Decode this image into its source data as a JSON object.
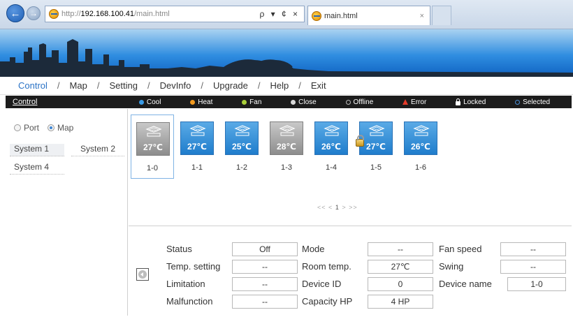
{
  "browser": {
    "url_proto": "http://",
    "url_host": "192.168.100.41",
    "url_path": "/main.html",
    "tools": "ρ ▾ ¢ ×",
    "tab_title": "main.html",
    "tab_close": "×"
  },
  "menu": {
    "items": [
      "Control",
      "Map",
      "Setting",
      "DevInfo",
      "Upgrade",
      "Help",
      "Exit"
    ],
    "active": "Control",
    "separator": "/"
  },
  "legend": {
    "title": "Control",
    "items": [
      {
        "label": "Cool",
        "color": "#3a9be6"
      },
      {
        "label": "Heat",
        "color": "#f29a1f"
      },
      {
        "label": "Fan",
        "color": "#a9cf3a"
      },
      {
        "label": "Close",
        "color": "#d9d9d9"
      },
      {
        "label": "Offline",
        "color": "#bbbbbb"
      },
      {
        "label": "Error",
        "color": "#e53b2a"
      },
      {
        "label": "Locked",
        "color": "#ffffff"
      },
      {
        "label": "Selected",
        "color": "#4a90d9"
      }
    ]
  },
  "left": {
    "modes": [
      "Port",
      "Map"
    ],
    "mode_selected": "Map",
    "systems": [
      "System 1",
      "System 2",
      "System 4"
    ],
    "system_selected": "System 1"
  },
  "devices": [
    {
      "name": "1-0",
      "temp": "27℃",
      "state": "offline",
      "selected": true,
      "locked": false
    },
    {
      "name": "1-1",
      "temp": "27℃",
      "state": "cool",
      "selected": false,
      "locked": false
    },
    {
      "name": "1-2",
      "temp": "25℃",
      "state": "cool",
      "selected": false,
      "locked": false
    },
    {
      "name": "1-3",
      "temp": "28℃",
      "state": "offline",
      "selected": false,
      "locked": false
    },
    {
      "name": "1-4",
      "temp": "26℃",
      "state": "cool",
      "selected": false,
      "locked": false
    },
    {
      "name": "1-5",
      "temp": "27℃",
      "state": "cool",
      "selected": false,
      "locked": true
    },
    {
      "name": "1-6",
      "temp": "26℃",
      "state": "cool",
      "selected": false,
      "locked": false
    }
  ],
  "pager": {
    "first": "<<",
    "prev": "<",
    "current": "1",
    "next": ">",
    "last": ">>"
  },
  "detail": {
    "status_label": "Status",
    "status_value": "Off",
    "temp_setting_label": "Temp. setting",
    "temp_setting_value": "--",
    "limitation_label": "Limitation",
    "limitation_value": "--",
    "malfunction_label": "Malfunction",
    "malfunction_value": "--",
    "mode_label": "Mode",
    "mode_value": "--",
    "room_temp_label": "Room temp.",
    "room_temp_value": "27℃",
    "device_id_label": "Device ID",
    "device_id_value": "0",
    "capacity_label": "Capacity HP",
    "capacity_value": "4  HP",
    "fan_speed_label": "Fan speed",
    "fan_speed_value": "--",
    "swing_label": "Swing",
    "swing_value": "--",
    "device_name_label": "Device name",
    "device_name_value": "1-0"
  }
}
